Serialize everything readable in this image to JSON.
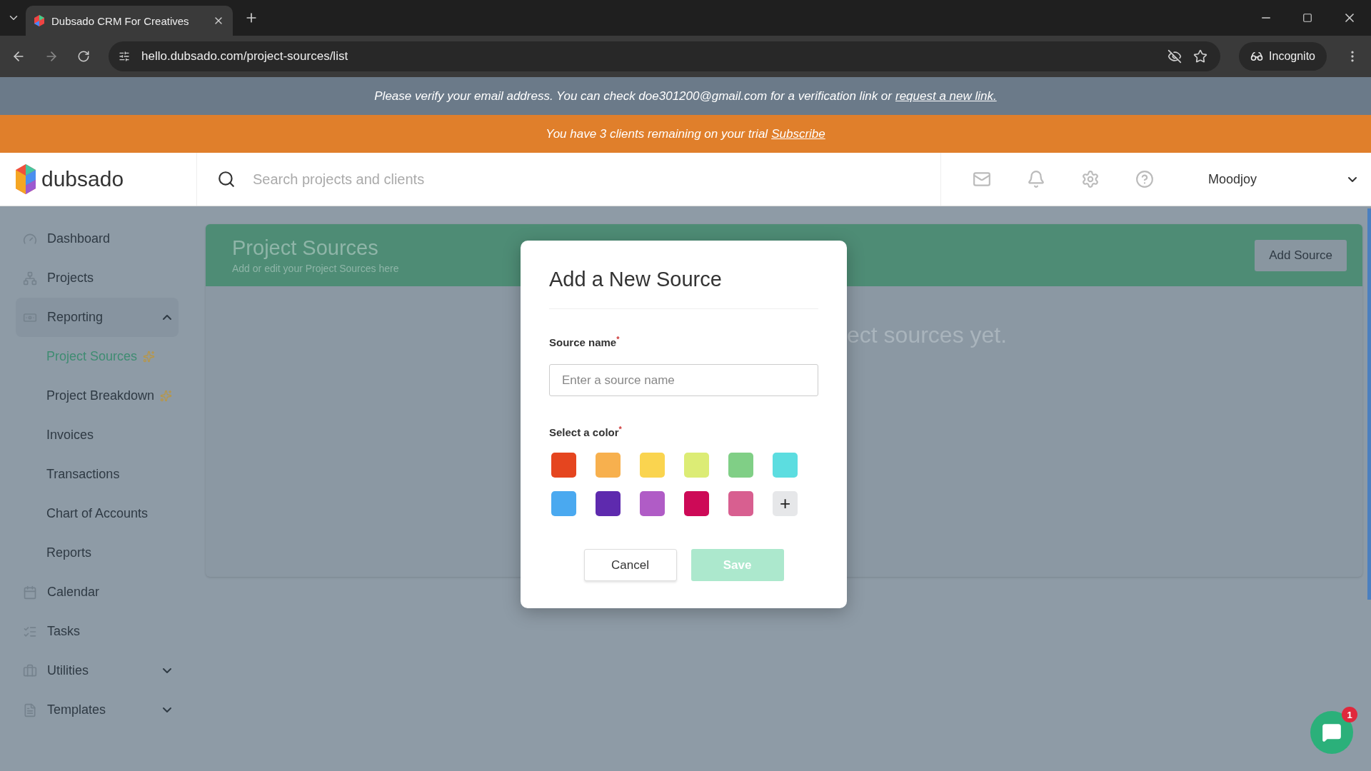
{
  "browser": {
    "tab_title": "Dubsado CRM For Creatives",
    "url": "hello.dubsado.com/project-sources/list",
    "profile": "Incognito"
  },
  "verify_banner": {
    "text": "Please verify your email address. You can check doe301200@gmail.com for a verification link or",
    "link": "request a new link."
  },
  "trial_banner": {
    "text": "You have 3 clients remaining on your trial",
    "link": "Subscribe"
  },
  "header": {
    "logo": "dubsado",
    "search": {
      "placeholder": "Search projects and clients"
    },
    "user": "Moodjoy"
  },
  "sidebar": {
    "items": [
      {
        "label": "Dashboard"
      },
      {
        "label": "Projects"
      },
      {
        "label": "Reporting",
        "expanded": true,
        "children": [
          {
            "label": "Project Sources",
            "selected": true,
            "new": true
          },
          {
            "label": "Project Breakdown",
            "selected": false,
            "new": true
          },
          {
            "label": "Invoices",
            "selected": false,
            "new": false
          },
          {
            "label": "Transactions",
            "selected": false,
            "new": false
          },
          {
            "label": "Chart of Accounts",
            "selected": false,
            "new": false
          },
          {
            "label": "Reports",
            "selected": false,
            "new": false
          }
        ]
      },
      {
        "label": "Calendar"
      },
      {
        "label": "Tasks"
      },
      {
        "label": "Utilities",
        "expanded": false
      },
      {
        "label": "Templates",
        "expanded": false
      }
    ]
  },
  "page": {
    "title": "Project Sources",
    "subtitle": "Add or edit your Project Sources here",
    "add_button": "Add Source",
    "empty_text": "ect sources yet."
  },
  "modal": {
    "title": "Add a New Source",
    "name_label": "Source name",
    "name_required": "*",
    "name_field": {
      "placeholder": "Enter a source name"
    },
    "color_label": "Select a color",
    "color_required": "*",
    "swatches": [
      {
        "kind": "swatch",
        "color": "#e5451f"
      },
      {
        "kind": "swatch",
        "color": "#f7b04e"
      },
      {
        "kind": "swatch",
        "color": "#fad44f"
      },
      {
        "kind": "swatch",
        "color": "#dcec75"
      },
      {
        "kind": "swatch",
        "color": "#80cf86"
      },
      {
        "kind": "swatch",
        "color": "#5cdde0"
      },
      {
        "kind": "swatch",
        "color": "#4aa9f0"
      },
      {
        "kind": "swatch",
        "color": "#5e2aae"
      },
      {
        "kind": "swatch",
        "color": "#b05cc6"
      },
      {
        "kind": "swatch",
        "color": "#cd0a57"
      },
      {
        "kind": "swatch",
        "color": "#d85f90"
      },
      {
        "kind": "add",
        "symbol": "+"
      }
    ],
    "cancel": "Cancel",
    "save": "Save",
    "save_disabled": true
  },
  "chat": {
    "badge": "1"
  }
}
